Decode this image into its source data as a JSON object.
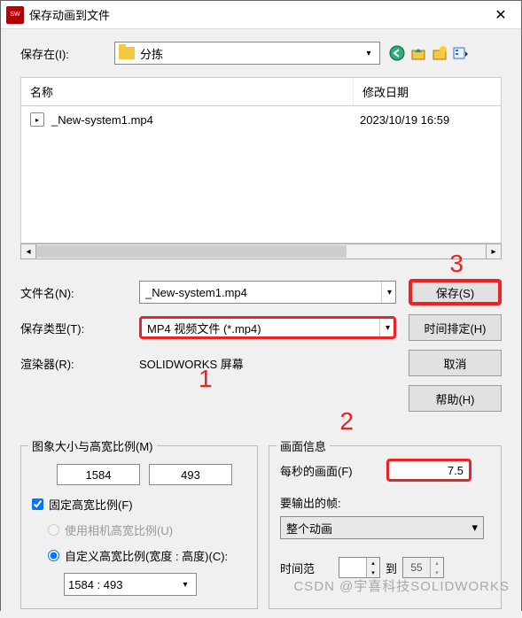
{
  "title": "保存动画到文件",
  "saveIn": {
    "label": "保存在(I):",
    "value": "分拣"
  },
  "columns": {
    "name": "名称",
    "date": "修改日期"
  },
  "files": [
    {
      "name": "_New-system1.mp4",
      "date": "2023/10/19 16:59"
    }
  ],
  "fileName": {
    "label": "文件名(N):",
    "value": "_New-system1.mp4"
  },
  "saveType": {
    "label": "保存类型(T):",
    "value": "MP4 视频文件 (*.mp4)"
  },
  "renderer": {
    "label": "渲染器(R):",
    "value": "SOLIDWORKS 屏幕"
  },
  "buttons": {
    "save": "保存(S)",
    "schedule": "时间排定(H)",
    "cancel": "取消",
    "help": "帮助(H)"
  },
  "imageSize": {
    "title": "图象大小与高宽比例(M)",
    "width": "1584",
    "height": "493",
    "fixed": "固定高宽比例(F)",
    "camera": "使用相机高宽比例(U)",
    "custom": "自定义高宽比例(宽度 : 高度)(C):",
    "ratio": "1584 : 493"
  },
  "frameInfo": {
    "title": "画面信息",
    "fpsLabel": "每秒的画面(F)",
    "fps": "7.5",
    "outputLabel": "要输出的帧:",
    "outputValue": "整个动画",
    "timeLabel": "时间范",
    "from": "",
    "toLabel": "到",
    "to": "55"
  },
  "annotations": {
    "a1": "1",
    "a2": "2",
    "a3": "3"
  },
  "watermark": "CSDN @宇喜科技SOLIDWORKS"
}
